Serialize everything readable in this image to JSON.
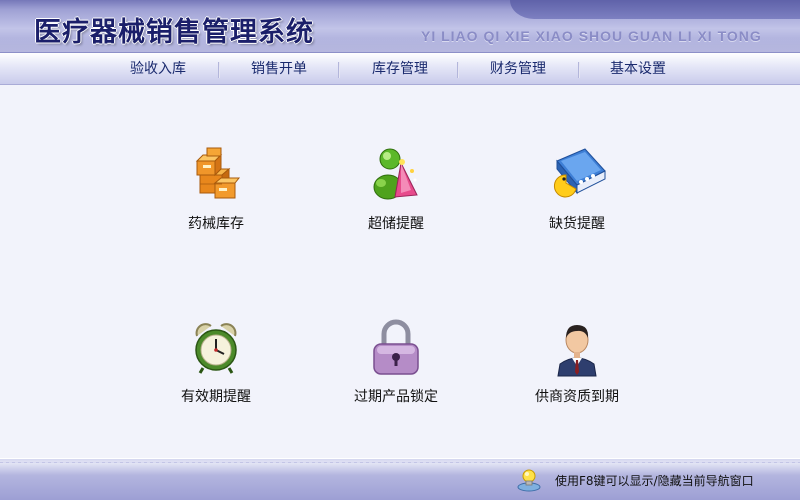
{
  "header": {
    "title": "医疗器械销售管理系统",
    "subtitle": "YI LIAO QI XIE XIAO SHOU GUAN LI XI TONG"
  },
  "nav": {
    "items": [
      {
        "label": "验收入库"
      },
      {
        "label": "销售开单"
      },
      {
        "label": "库存管理"
      },
      {
        "label": "财务管理"
      },
      {
        "label": "基本设置"
      }
    ]
  },
  "main": {
    "tiles": [
      {
        "label": "药械库存",
        "icon": "boxes-icon"
      },
      {
        "label": "超储提醒",
        "icon": "msn-buddy-icon"
      },
      {
        "label": "缺货提醒",
        "icon": "pacman-book-icon"
      },
      {
        "label": "有效期提醒",
        "icon": "alarm-clock-icon"
      },
      {
        "label": "过期产品锁定",
        "icon": "padlock-icon"
      },
      {
        "label": "供商资质到期",
        "icon": "businessman-icon"
      }
    ]
  },
  "status": {
    "text": "使用F8键可以显示/隐藏当前导航窗口",
    "icon": "lightbulb-icon"
  },
  "colors": {
    "title": "#1b1f6a",
    "nav_text": "#1a2a6e",
    "header_dark": "#7577b9",
    "page_bg": "#f2f3fb"
  }
}
